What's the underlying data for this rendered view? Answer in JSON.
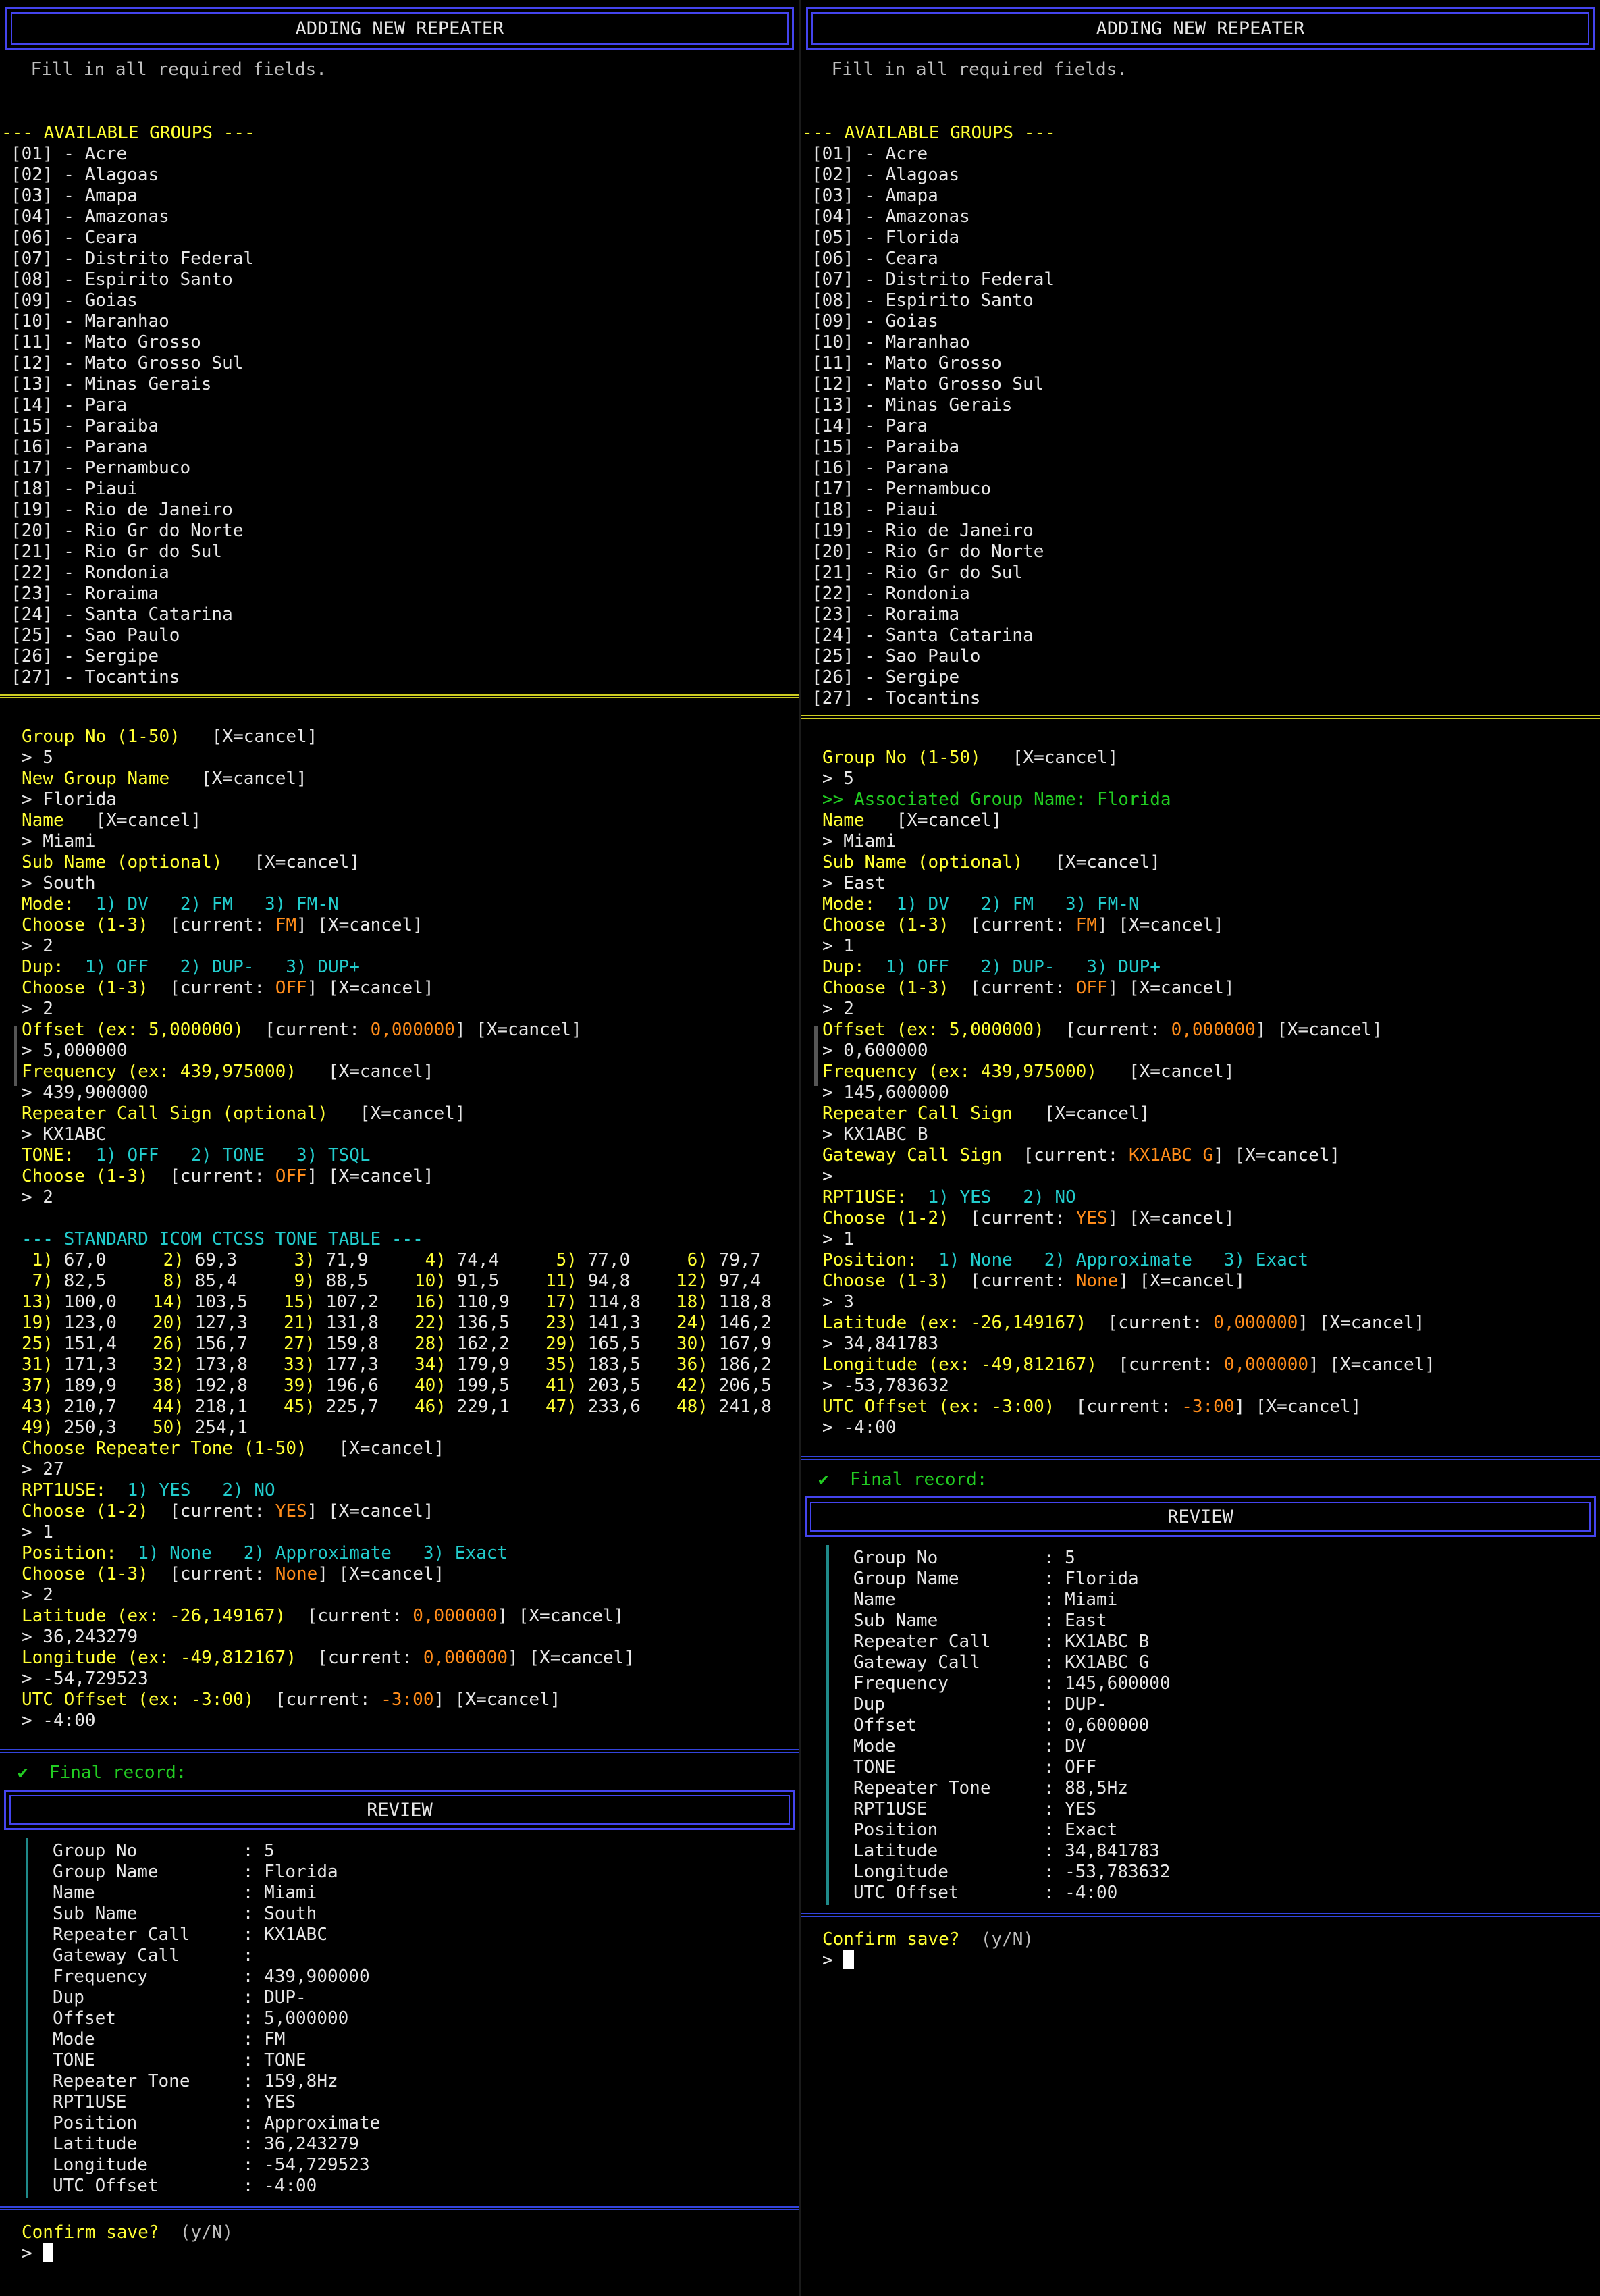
{
  "header": {
    "title": "ADDING NEW REPEATER",
    "hint": "Fill in all required fields."
  },
  "groups_heading": "--- AVAILABLE GROUPS ---",
  "left": {
    "groups": [
      "[01] - Acre",
      "[02] - Alagoas",
      "[03] - Amapa",
      "[04] - Amazonas",
      "[06] - Ceara",
      "[07] - Distrito Federal",
      "[08] - Espirito Santo",
      "[09] - Goias",
      "[10] - Maranhao",
      "[11] - Mato Grosso",
      "[12] - Mato Grosso Sul",
      "[13] - Minas Gerais",
      "[14] - Para",
      "[15] - Paraiba",
      "[16] - Parana",
      "[17] - Pernambuco",
      "[18] - Piaui",
      "[19] - Rio de Janeiro",
      "[20] - Rio Gr do Norte",
      "[21] - Rio Gr do Sul",
      "[22] - Rondonia",
      "[23] - Roraima",
      "[24] - Santa Catarina",
      "[25] - Sao Paulo",
      "[26] - Sergipe",
      "[27] - Tocantins"
    ],
    "prompts": [
      [
        {
          "t": "Group No (1-50)",
          "c": "y"
        },
        {
          "t": "   [X=cancel]",
          "c": "w"
        }
      ],
      [
        {
          "t": "> 5",
          "c": "w"
        }
      ],
      [
        {
          "t": "New Group Name",
          "c": "y"
        },
        {
          "t": "   [X=cancel]",
          "c": "w"
        }
      ],
      [
        {
          "t": "> Florida",
          "c": "w"
        }
      ],
      [
        {
          "t": "Name",
          "c": "y"
        },
        {
          "t": "   [X=cancel]",
          "c": "w"
        }
      ],
      [
        {
          "t": "> Miami",
          "c": "w"
        }
      ],
      [
        {
          "t": "Sub Name (optional)",
          "c": "y"
        },
        {
          "t": "   [X=cancel]",
          "c": "w"
        }
      ],
      [
        {
          "t": "> South",
          "c": "w"
        }
      ],
      [
        {
          "t": "Mode:",
          "c": "y"
        },
        {
          "t": "  1) DV   2) FM   3) FM-N",
          "c": "c"
        }
      ],
      [
        {
          "t": "Choose (1-3)",
          "c": "y"
        },
        {
          "t": "  [current: ",
          "c": "w"
        },
        {
          "t": "FM",
          "c": "o"
        },
        {
          "t": "] [X=cancel]",
          "c": "w"
        }
      ],
      [
        {
          "t": "> 2",
          "c": "w"
        }
      ],
      [
        {
          "t": "Dup:",
          "c": "y"
        },
        {
          "t": "  1) OFF   2) DUP-   3) DUP+",
          "c": "c"
        }
      ],
      [
        {
          "t": "Choose (1-3)",
          "c": "y"
        },
        {
          "t": "  [current: ",
          "c": "w"
        },
        {
          "t": "OFF",
          "c": "o"
        },
        {
          "t": "] [X=cancel]",
          "c": "w"
        }
      ],
      [
        {
          "t": "> 2",
          "c": "w"
        }
      ],
      [
        {
          "t": "Offset (ex: 5,000000)",
          "c": "y"
        },
        {
          "t": "  [current: ",
          "c": "w"
        },
        {
          "t": "0,000000",
          "c": "o"
        },
        {
          "t": "] [X=cancel]",
          "c": "w"
        }
      ],
      [
        {
          "t": "> 5,000000",
          "c": "w"
        }
      ],
      [
        {
          "t": "Frequency (ex: 439,975000)",
          "c": "y"
        },
        {
          "t": "   [X=cancel]",
          "c": "w"
        }
      ],
      [
        {
          "t": "> 439,900000",
          "c": "w"
        }
      ],
      [
        {
          "t": "Repeater Call Sign (optional)",
          "c": "y"
        },
        {
          "t": "   [X=cancel]",
          "c": "w"
        }
      ],
      [
        {
          "t": "> KX1ABC",
          "c": "w"
        }
      ],
      [
        {
          "t": "TONE:",
          "c": "y"
        },
        {
          "t": "  1) OFF   2) TONE   3) TSQL",
          "c": "c"
        }
      ],
      [
        {
          "t": "Choose (1-3)",
          "c": "y"
        },
        {
          "t": "  [current: ",
          "c": "w"
        },
        {
          "t": "OFF",
          "c": "o"
        },
        {
          "t": "] [X=cancel]",
          "c": "w"
        }
      ],
      [
        {
          "t": "> 2",
          "c": "w"
        }
      ]
    ],
    "tone_table_heading": "--- STANDARD ICOM CTCSS TONE TABLE ---",
    "tone_table": [
      [
        " 1)",
        "67,0",
        " 2)",
        "69,3",
        " 3)",
        "71,9",
        " 4)",
        "74,4",
        " 5)",
        "77,0",
        " 6)",
        "79,7"
      ],
      [
        " 7)",
        "82,5",
        " 8)",
        "85,4",
        " 9)",
        "88,5",
        "10)",
        "91,5",
        "11)",
        "94,8",
        "12)",
        "97,4"
      ],
      [
        "13)",
        "100,0",
        "14)",
        "103,5",
        "15)",
        "107,2",
        "16)",
        "110,9",
        "17)",
        "114,8",
        "18)",
        "118,8"
      ],
      [
        "19)",
        "123,0",
        "20)",
        "127,3",
        "21)",
        "131,8",
        "22)",
        "136,5",
        "23)",
        "141,3",
        "24)",
        "146,2"
      ],
      [
        "25)",
        "151,4",
        "26)",
        "156,7",
        "27)",
        "159,8",
        "28)",
        "162,2",
        "29)",
        "165,5",
        "30)",
        "167,9"
      ],
      [
        "31)",
        "171,3",
        "32)",
        "173,8",
        "33)",
        "177,3",
        "34)",
        "179,9",
        "35)",
        "183,5",
        "36)",
        "186,2"
      ],
      [
        "37)",
        "189,9",
        "38)",
        "192,8",
        "39)",
        "196,6",
        "40)",
        "199,5",
        "41)",
        "203,5",
        "42)",
        "206,5"
      ],
      [
        "43)",
        "210,7",
        "44)",
        "218,1",
        "45)",
        "225,7",
        "46)",
        "229,1",
        "47)",
        "233,6",
        "48)",
        "241,8"
      ],
      [
        "49)",
        "250,3",
        "50)",
        "254,1"
      ]
    ],
    "prompts2": [
      [
        {
          "t": "Choose Repeater Tone (1-50)",
          "c": "y"
        },
        {
          "t": "   [X=cancel]",
          "c": "w"
        }
      ],
      [
        {
          "t": "> 27",
          "c": "w"
        }
      ],
      [
        {
          "t": "RPT1USE:",
          "c": "y"
        },
        {
          "t": "  1) YES   2) NO",
          "c": "c"
        }
      ],
      [
        {
          "t": "Choose (1-2)",
          "c": "y"
        },
        {
          "t": "  [current: ",
          "c": "w"
        },
        {
          "t": "YES",
          "c": "o"
        },
        {
          "t": "] [X=cancel]",
          "c": "w"
        }
      ],
      [
        {
          "t": "> 1",
          "c": "w"
        }
      ],
      [
        {
          "t": "Position:",
          "c": "y"
        },
        {
          "t": "  1) None   2) Approximate   3) Exact",
          "c": "c"
        }
      ],
      [
        {
          "t": "Choose (1-3)",
          "c": "y"
        },
        {
          "t": "  [current: ",
          "c": "w"
        },
        {
          "t": "None",
          "c": "o"
        },
        {
          "t": "] [X=cancel]",
          "c": "w"
        }
      ],
      [
        {
          "t": "> 2",
          "c": "w"
        }
      ],
      [
        {
          "t": "Latitude (ex: -26,149167)",
          "c": "y"
        },
        {
          "t": "  [current: ",
          "c": "w"
        },
        {
          "t": "0,000000",
          "c": "o"
        },
        {
          "t": "] [X=cancel]",
          "c": "w"
        }
      ],
      [
        {
          "t": "> 36,243279",
          "c": "w"
        }
      ],
      [
        {
          "t": "Longitude (ex: -49,812167)",
          "c": "y"
        },
        {
          "t": "  [current: ",
          "c": "w"
        },
        {
          "t": "0,000000",
          "c": "o"
        },
        {
          "t": "] [X=cancel]",
          "c": "w"
        }
      ],
      [
        {
          "t": "> -54,729523",
          "c": "w"
        }
      ],
      [
        {
          "t": "UTC Offset (ex: -3:00)",
          "c": "y"
        },
        {
          "t": "  [current: ",
          "c": "w"
        },
        {
          "t": "-3:00",
          "c": "o"
        },
        {
          "t": "] [X=cancel]",
          "c": "w"
        }
      ],
      [
        {
          "t": "> -4:00",
          "c": "w"
        }
      ]
    ],
    "final_record": "✔  Final record:",
    "review_title": "REVIEW",
    "review": [
      [
        "Group No",
        "5"
      ],
      [
        "Group Name",
        "Florida"
      ],
      [
        "Name",
        "Miami"
      ],
      [
        "Sub Name",
        "South"
      ],
      [
        "Repeater Call",
        "KX1ABC"
      ],
      [
        "Gateway Call",
        ""
      ],
      [
        "Frequency",
        "439,900000"
      ],
      [
        "Dup",
        "DUP-"
      ],
      [
        "Offset",
        "5,000000"
      ],
      [
        "Mode",
        "FM"
      ],
      [
        "TONE",
        "TONE"
      ],
      [
        "Repeater Tone",
        "159,8Hz"
      ],
      [
        "RPT1USE",
        "YES"
      ],
      [
        "Position",
        "Approximate"
      ],
      [
        "Latitude",
        "36,243279"
      ],
      [
        "Longitude",
        "-54,729523"
      ],
      [
        "UTC Offset",
        "-4:00"
      ]
    ],
    "confirm": "Confirm save?",
    "confirm_hint": "  (y/N)",
    "input_prompt": "> "
  },
  "right": {
    "groups": [
      "[01] - Acre",
      "[02] - Alagoas",
      "[03] - Amapa",
      "[04] - Amazonas",
      "[05] - Florida",
      "[06] - Ceara",
      "[07] - Distrito Federal",
      "[08] - Espirito Santo",
      "[09] - Goias",
      "[10] - Maranhao",
      "[11] - Mato Grosso",
      "[12] - Mato Grosso Sul",
      "[13] - Minas Gerais",
      "[14] - Para",
      "[15] - Paraiba",
      "[16] - Parana",
      "[17] - Pernambuco",
      "[18] - Piaui",
      "[19] - Rio de Janeiro",
      "[20] - Rio Gr do Norte",
      "[21] - Rio Gr do Sul",
      "[22] - Rondonia",
      "[23] - Roraima",
      "[24] - Santa Catarina",
      "[25] - Sao Paulo",
      "[26] - Sergipe",
      "[27] - Tocantins"
    ],
    "prompts": [
      [
        {
          "t": "Group No (1-50)",
          "c": "y"
        },
        {
          "t": "   [X=cancel]",
          "c": "w"
        }
      ],
      [
        {
          "t": "> 5",
          "c": "w"
        }
      ],
      [
        {
          "t": ">> Associated Group Name: Florida",
          "c": "g"
        }
      ],
      [
        {
          "t": "Name",
          "c": "y"
        },
        {
          "t": "   [X=cancel]",
          "c": "w"
        }
      ],
      [
        {
          "t": "> Miami",
          "c": "w"
        }
      ],
      [
        {
          "t": "Sub Name (optional)",
          "c": "y"
        },
        {
          "t": "   [X=cancel]",
          "c": "w"
        }
      ],
      [
        {
          "t": "> East",
          "c": "w"
        }
      ],
      [
        {
          "t": "Mode:",
          "c": "y"
        },
        {
          "t": "  1) DV   2) FM   3) FM-N",
          "c": "c"
        }
      ],
      [
        {
          "t": "Choose (1-3)",
          "c": "y"
        },
        {
          "t": "  [current: ",
          "c": "w"
        },
        {
          "t": "FM",
          "c": "o"
        },
        {
          "t": "] [X=cancel]",
          "c": "w"
        }
      ],
      [
        {
          "t": "> 1",
          "c": "w"
        }
      ],
      [
        {
          "t": "Dup:",
          "c": "y"
        },
        {
          "t": "  1) OFF   2) DUP-   3) DUP+",
          "c": "c"
        }
      ],
      [
        {
          "t": "Choose (1-3)",
          "c": "y"
        },
        {
          "t": "  [current: ",
          "c": "w"
        },
        {
          "t": "OFF",
          "c": "o"
        },
        {
          "t": "] [X=cancel]",
          "c": "w"
        }
      ],
      [
        {
          "t": "> 2",
          "c": "w"
        }
      ],
      [
        {
          "t": "Offset (ex: 5,000000)",
          "c": "y"
        },
        {
          "t": "  [current: ",
          "c": "w"
        },
        {
          "t": "0,000000",
          "c": "o"
        },
        {
          "t": "] [X=cancel]",
          "c": "w"
        }
      ],
      [
        {
          "t": "> 0,600000",
          "c": "w"
        }
      ],
      [
        {
          "t": "Frequency (ex: 439,975000)",
          "c": "y"
        },
        {
          "t": "   [X=cancel]",
          "c": "w"
        }
      ],
      [
        {
          "t": "> 145,600000",
          "c": "w"
        }
      ],
      [
        {
          "t": "Repeater Call Sign",
          "c": "y"
        },
        {
          "t": "   [X=cancel]",
          "c": "w"
        }
      ],
      [
        {
          "t": "> KX1ABC B",
          "c": "w"
        }
      ],
      [
        {
          "t": "Gateway Call Sign",
          "c": "y"
        },
        {
          "t": "  [current: ",
          "c": "w"
        },
        {
          "t": "KX1ABC G",
          "c": "o"
        },
        {
          "t": "] [X=cancel]",
          "c": "w"
        }
      ],
      [
        {
          "t": ">",
          "c": "w"
        }
      ],
      [
        {
          "t": "RPT1USE:",
          "c": "y"
        },
        {
          "t": "  1) YES   2) NO",
          "c": "c"
        }
      ],
      [
        {
          "t": "Choose (1-2)",
          "c": "y"
        },
        {
          "t": "  [current: ",
          "c": "w"
        },
        {
          "t": "YES",
          "c": "o"
        },
        {
          "t": "] [X=cancel]",
          "c": "w"
        }
      ],
      [
        {
          "t": "> 1",
          "c": "w"
        }
      ],
      [
        {
          "t": "Position:",
          "c": "y"
        },
        {
          "t": "  1) None   2) Approximate   3) Exact",
          "c": "c"
        }
      ],
      [
        {
          "t": "Choose (1-3)",
          "c": "y"
        },
        {
          "t": "  [current: ",
          "c": "w"
        },
        {
          "t": "None",
          "c": "o"
        },
        {
          "t": "] [X=cancel]",
          "c": "w"
        }
      ],
      [
        {
          "t": "> 3",
          "c": "w"
        }
      ],
      [
        {
          "t": "Latitude (ex: -26,149167)",
          "c": "y"
        },
        {
          "t": "  [current: ",
          "c": "w"
        },
        {
          "t": "0,000000",
          "c": "o"
        },
        {
          "t": "] [X=cancel]",
          "c": "w"
        }
      ],
      [
        {
          "t": "> 34,841783",
          "c": "w"
        }
      ],
      [
        {
          "t": "Longitude (ex: -49,812167)",
          "c": "y"
        },
        {
          "t": "  [current: ",
          "c": "w"
        },
        {
          "t": "0,000000",
          "c": "o"
        },
        {
          "t": "] [X=cancel]",
          "c": "w"
        }
      ],
      [
        {
          "t": "> -53,783632",
          "c": "w"
        }
      ],
      [
        {
          "t": "UTC Offset (ex: -3:00)",
          "c": "y"
        },
        {
          "t": "  [current: ",
          "c": "w"
        },
        {
          "t": "-3:00",
          "c": "o"
        },
        {
          "t": "] [X=cancel]",
          "c": "w"
        }
      ],
      [
        {
          "t": "> -4:00",
          "c": "w"
        }
      ]
    ],
    "final_record": "✔  Final record:",
    "review_title": "REVIEW",
    "review": [
      [
        "Group No",
        "5"
      ],
      [
        "Group Name",
        "Florida"
      ],
      [
        "Name",
        "Miami"
      ],
      [
        "Sub Name",
        "East"
      ],
      [
        "Repeater Call",
        "KX1ABC B"
      ],
      [
        "Gateway Call",
        "KX1ABC G"
      ],
      [
        "Frequency",
        "145,600000"
      ],
      [
        "Dup",
        "DUP-"
      ],
      [
        "Offset",
        "0,600000"
      ],
      [
        "Mode",
        "DV"
      ],
      [
        "TONE",
        "OFF"
      ],
      [
        "Repeater Tone",
        "88,5Hz"
      ],
      [
        "RPT1USE",
        "YES"
      ],
      [
        "Position",
        "Exact"
      ],
      [
        "Latitude",
        "34,841783"
      ],
      [
        "Longitude",
        "-53,783632"
      ],
      [
        "UTC Offset",
        "-4:00"
      ]
    ],
    "confirm": "Confirm save?",
    "confirm_hint": "  (y/N)",
    "input_prompt": "> "
  },
  "colors": {
    "prompt": "#ffff33",
    "option": "#22cccc",
    "current": "#ff8c1a",
    "success": "#22cc22",
    "border": "#4444ee",
    "separator": "#cccc22"
  }
}
